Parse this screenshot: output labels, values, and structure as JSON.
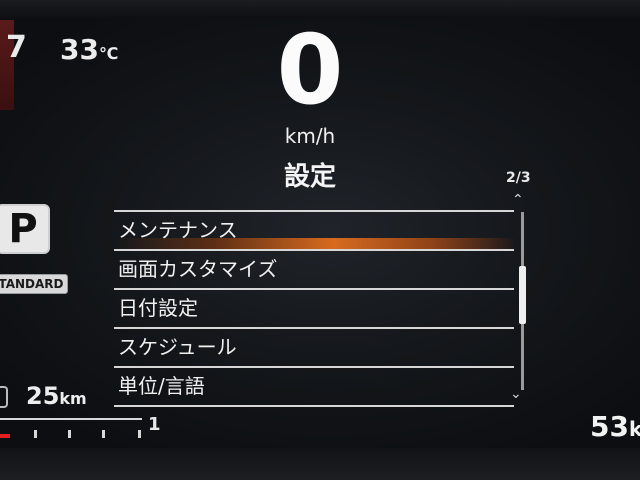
{
  "status": {
    "odometer_partial": "7",
    "outside_temp": "33",
    "temp_unit": "℃",
    "range_value": "25",
    "range_unit": "km",
    "fuel_full_label": "1",
    "trip_value": "53",
    "trip_unit": "k"
  },
  "speed": {
    "value": "0",
    "unit": "km/h"
  },
  "gear": {
    "position": "P",
    "drive_mode": "TANDARD"
  },
  "menu": {
    "title": "設定",
    "page_indicator": "2/3",
    "selected_index": 0,
    "items": [
      {
        "label": "メンテナンス"
      },
      {
        "label": "画面カスタマイズ"
      },
      {
        "label": "日付設定"
      },
      {
        "label": "スケジュール"
      },
      {
        "label": "単位/言語"
      }
    ]
  },
  "icons": {
    "scroll_up": "chevron-up-icon",
    "scroll_down": "chevron-down-icon",
    "fuel": "fuel-gauge-icon"
  },
  "colors": {
    "highlight": "#e06e1e",
    "fuel_low": "#e02020",
    "text": "#f2f2f2",
    "background": "#0b0d10"
  }
}
